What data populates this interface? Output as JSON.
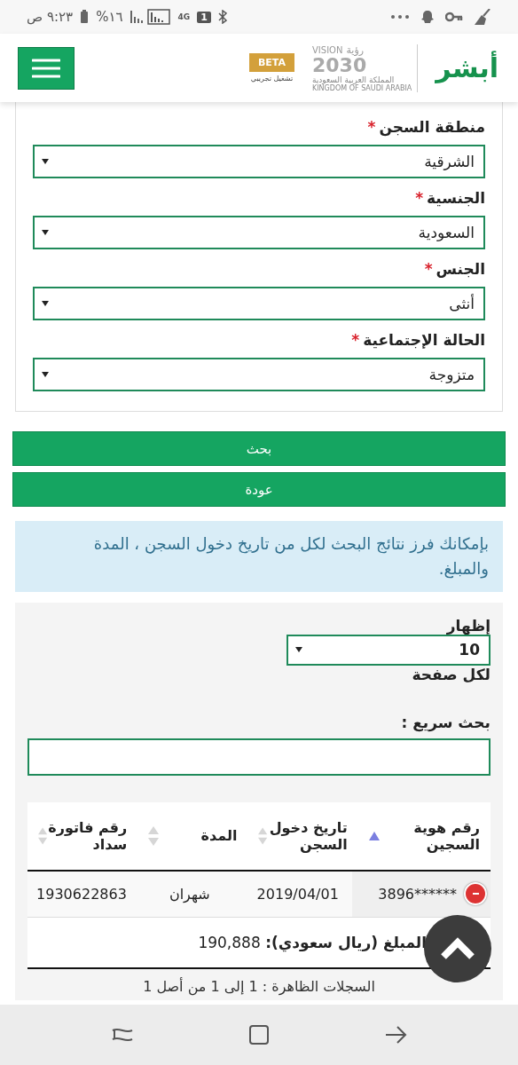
{
  "status_bar": {
    "time": "٩:٢٣ ص",
    "battery": "%١٦",
    "network": "4G",
    "sim": "1"
  },
  "header": {
    "beta_badge": "BETA",
    "beta_caption": "تشغيل تجريبي",
    "vision_logo": {
      "word_en": "VISION",
      "word_ar": "رؤية",
      "year": "2030",
      "country_ar": "المملكة العربية السعودية",
      "country_en": "KINGDOM OF SAUDI ARABIA"
    },
    "brand": "أبشر"
  },
  "form": {
    "fields": [
      {
        "label": "منطقة السجن",
        "required_mark": "*",
        "value": "الشرقية"
      },
      {
        "label": "الجنسية",
        "required_mark": "*",
        "value": "السعودية"
      },
      {
        "label": "الجنس",
        "required_mark": "*",
        "value": "أنثى"
      },
      {
        "label": "الحالة الإجتماعية",
        "required_mark": "*",
        "value": "متزوجة"
      }
    ]
  },
  "buttons": [
    {
      "label": "بحث"
    },
    {
      "label": "عودة"
    }
  ],
  "info_note": "بإمكانك فرز نتائج البحث لكل من تاريخ دخول السجن ، المدة والمبلغ.",
  "results": {
    "show_label": "إظهار",
    "page_size": "10",
    "per_page_label": "لكل صفحة",
    "quick_search_label": "بحث سريع :",
    "columns": [
      {
        "label": "رقم هوية السجين",
        "sorted": true
      },
      {
        "label": "تاريخ دخول السجن",
        "sorted": false
      },
      {
        "label": "المدة",
        "sorted": false
      },
      {
        "label": "رقم فاتورة سداد",
        "sorted": false
      }
    ],
    "rows": [
      {
        "expanded": true,
        "cells": [
          "******3896",
          "2019/04/01",
          "شهران",
          "1930622863"
        ],
        "detail": "**المبلغ (ريال سعودي):** 190,888"
      }
    ],
    "footer": "السجلات الظاهرة : 1 إلى 1 من أصل 1"
  }
}
